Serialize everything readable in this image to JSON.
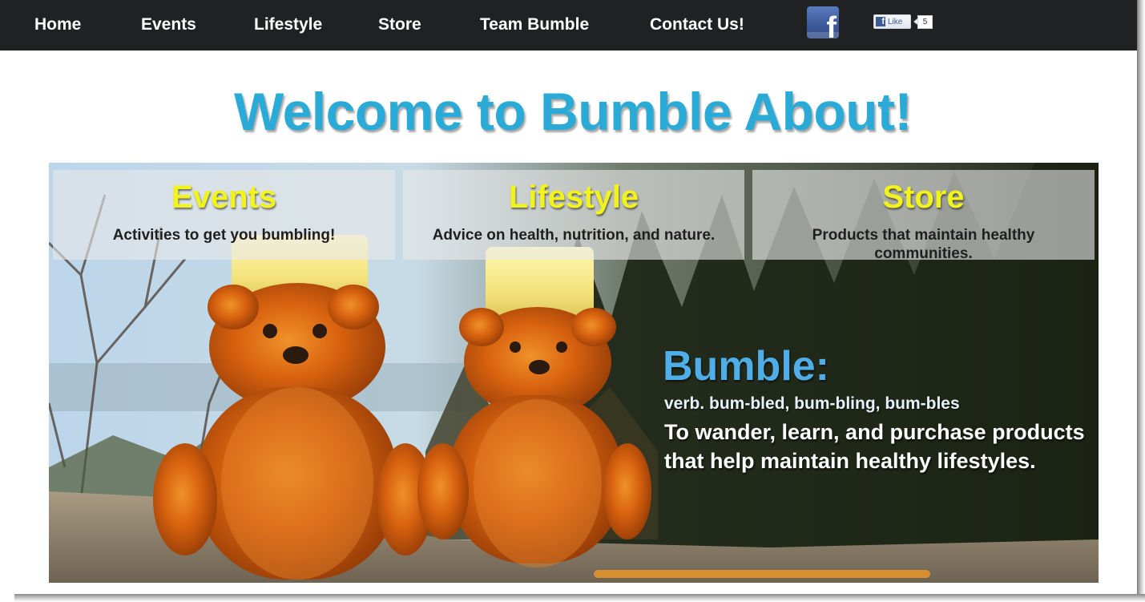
{
  "nav": {
    "items": [
      {
        "label": "Home"
      },
      {
        "label": "Events"
      },
      {
        "label": "Lifestyle"
      },
      {
        "label": "Store"
      },
      {
        "label": "Team Bumble"
      },
      {
        "label": "Contact Us!"
      }
    ],
    "facebook_icon": "facebook-icon",
    "like": {
      "label": "Like",
      "count": "5"
    }
  },
  "welcome": {
    "title": "Welcome to Bumble About!"
  },
  "hero": {
    "panels": [
      {
        "title": "Events",
        "description": "Activities to get you bumbling!"
      },
      {
        "title": "Lifestyle",
        "description": "Advice on health, nutrition, and nature."
      },
      {
        "title": "Store",
        "description": "Products that maintain healthy communities."
      }
    ],
    "definition": {
      "word": "Bumble:",
      "part_of_speech": "verb. bum-bled, bum-bling, bum-bles",
      "meaning": "To wander, learn, and purchase products that help maintain healthy lifestyles."
    },
    "image": "two honey bear bottles on a rock in front of trees"
  },
  "colors": {
    "nav_background": "#1f2122",
    "title_blue": "#2aaad6",
    "panel_title_yellow": "#f2f21d",
    "bumble_blue": "#4faee8"
  }
}
